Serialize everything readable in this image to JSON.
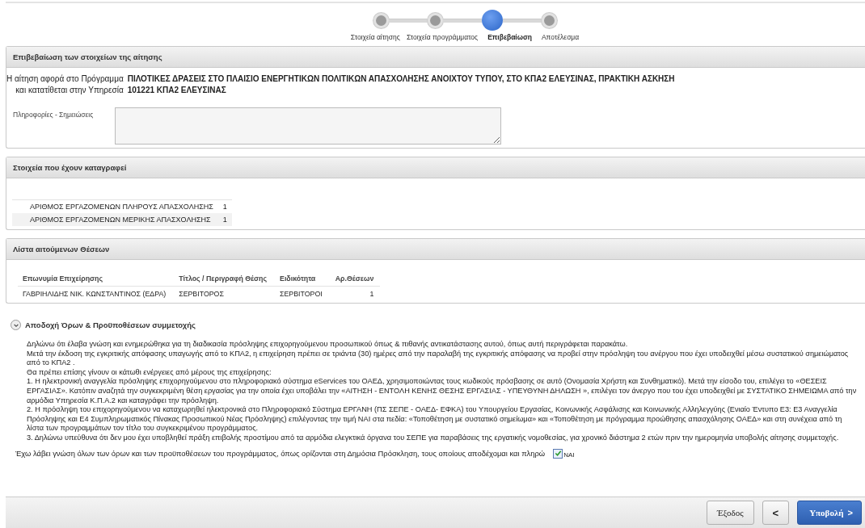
{
  "steps": [
    {
      "label": "Στοιχεία αίτησης",
      "selected": false
    },
    {
      "label": "Στοιχεία προγράμματος",
      "selected": false
    },
    {
      "label": "Επιβεβαίωση",
      "selected": true
    },
    {
      "label": "Αποτέλεσμα",
      "selected": false
    }
  ],
  "confirmation": {
    "title": "Επιβεβαίωση των στοιχείων της αίτησης",
    "fields": [
      {
        "label": "Η αίτηση αφορά στο Πρόγραμμα",
        "value": "ΠΙΛΟΤΙΚΕΣ ΔΡΑΣΕΙΣ ΣΤΟ ΠΛΑΙΣΙΟ ΕΝΕΡΓΗΤΙΚΩΝ ΠΟΛΙΤΙΚΩΝ ΑΠΑΣΧΟΛΗΣΗΣ ΑΝΟΙΧΤΟΥ ΤΥΠΟΥ, ΣΤΟ ΚΠΑ2 ΕΛΕΥΣΙΝΑΣ, ΠΡΑΚΤΙΚΗ ΑΣΚΗΣΗ"
      },
      {
        "label": "και κατατίθεται στην Υπηρεσία",
        "value": "101221 ΚΠΑ2 ΕΛΕΥΣΙΝΑΣ"
      }
    ],
    "notes_label": "Πληροφορίες - Σημειώσεις"
  },
  "recorded": {
    "title": "Στοιχεία που έχουν καταγραφεί",
    "rows": [
      {
        "label": "ΑΡΙΘΜΟΣ ΕΡΓΑΖΟΜΕΝΩΝ ΠΛΗΡΟΥΣ ΑΠΑΣΧΟΛΗΣΗΣ",
        "value": "1"
      },
      {
        "label": "ΑΡΙΘΜΟΣ ΕΡΓΑΖΟΜΕΝΩΝ ΜΕΡΙΚΗΣ ΑΠΑΣΧΟΛΗΣΗΣ",
        "value": "1"
      }
    ]
  },
  "positions": {
    "title": "Λίστα αιτούμενων Θέσεων",
    "columns": [
      "Επωνυμία Επιχείρησης",
      "Τίτλος / Περιγραφή Θέσης",
      "Ειδικότητα",
      "Αρ.Θέσεων"
    ],
    "rows": [
      [
        "ΓΑΒΡΙΗΛΙΔΗΣ ΝΙΚ. ΚΩΝΣΤΑΝΤΙΝΟΣ (ΕΔΡΑ)",
        "ΣΕΡΒΙΤΟΡΟΣ",
        "ΣΕΡΒΙΤΟΡΟΙ",
        "1"
      ]
    ]
  },
  "terms": {
    "title": "Αποδοχή Όρων & Προϋποθέσεων συμμετοχής",
    "expanded": true,
    "paragraphs": [
      "Δηλώνω ότι έλαβα γνώση και ενημερώθηκα για τη διαδικασία πρόσληψης επιχορηγούμενου προσωπικού όπως & πιθανής αντικατάστασης αυτού, όπως αυτή περιγράφεται παρακάτω.",
      "Μετά την έκδοση της εγκριτικής απόφασης υπαγωγής από το ΚΠΑ2, η επιχείρηση πρέπει σε τριάντα (30) ημέρες από την παραλαβή της εγκριτικής απόφασης να προβεί στην πρόσληψη του ανέργου που έχει υποδειχθεί μέσω συστατικού σημειώματος από το ΚΠΑ2 .",
      "Θα πρέπει επίσης γίνουν οι κάτωθι ενέργειες από μέρους της επιχείρησης:",
      "1. Η ηλεκτρονική αναγγελία πρόσληψης επιχορηγούμενου στο πληροφοριακό σύστημα eServices του ΟΑΕΔ, χρησιμοποιώντας τους κωδικούς πρόσβασης σε αυτό (Ονομασία Χρήστη και Συνθηματικό). Μετά την είσοδο του, επιλέγει το «ΘΕΣΕΙΣ ΕΡΓΑΣΙΑΣ». Κατόπιν αναζητά την συγκεκριμένη θέση εργασίας για την οποία έχει υποβάλει την «ΑΙΤΗΣΗ - ΕΝΤΟΛΗ ΚΕΝΗΣ ΘΕΣΗΣ ΕΡΓΑΣΙΑΣ - ΥΠΕΥΘΥΝΗ ΔΗΛΩΣΗ », επιλέγει τον άνεργο που του έχει υποδειχθεί με ΣΥΣΤΑΤΙΚΟ ΣΗΜΕΙΩΜΑ από την αρμόδια Υπηρεσία Κ.Π.Α.2 και καταγράφει την πρόσληψη.",
      "2. Η πρόσληψη του επιχορηγούμενου να καταχωρηθεί ηλεκτρονικά στο Πληροφοριακό Σύστημα ΕΡΓΑΝΗ (ΠΣ ΣΕΠΕ - ΟΑΕΔ- ΕΦΚΑ) του Υπουργείου Εργασίας, Κοινωνικής Ασφάλισης και Κοινωνικής Αλληλεγγύης (Ενιαίο Έντυπο Ε3: Ε3 Αναγγελία Πρόσληψης και Ε4 Συμπληρωματικός Πίνακας Προσωπικού Νέας Πρόσληψης) επιλέγοντας την τιμή ΝΑΙ στα πεδία: «Τοποθέτηση με συστατικό σημείωμα» και «Τοποθέτηση με πρόγραμμα προώθησης απασχόλησης ΟΑΕΔ» και στη συνέχεια από τη λίστα των προγραμμάτων τον τίτλο του συγκεκριμένου προγράμματος.",
      "3. Δηλώνω υπεύθυνα ότι δεν μου έχει υποβληθεί πράξη επιβολής προστίμου από τα αρμόδια ελεγκτικά όργανα του ΣΕΠΕ για παραβάσεις της εργατικής νομοθεσίας, για χρονικό διάστημα 2 ετών πριν την ημερομηνία υποβολής αίτησης συμμετοχής."
    ],
    "acceptance": "Έχω λάβει γνώση όλων των όρων και των προϋποθέσεων του προγράμματος, όπως ορίζονται στη Δημόσια Πρόσκληση, τους οποίους αποδέχομαι και πληρώ",
    "checkbox": {
      "label": "ΝΑΙ",
      "checked": true
    }
  },
  "footer": {
    "buttons": [
      {
        "kind": "plain",
        "label": "Έξοδος"
      },
      {
        "kind": "back",
        "label": "<"
      },
      {
        "kind": "primary",
        "label": "Υποβολή",
        "caret": ">"
      }
    ]
  }
}
